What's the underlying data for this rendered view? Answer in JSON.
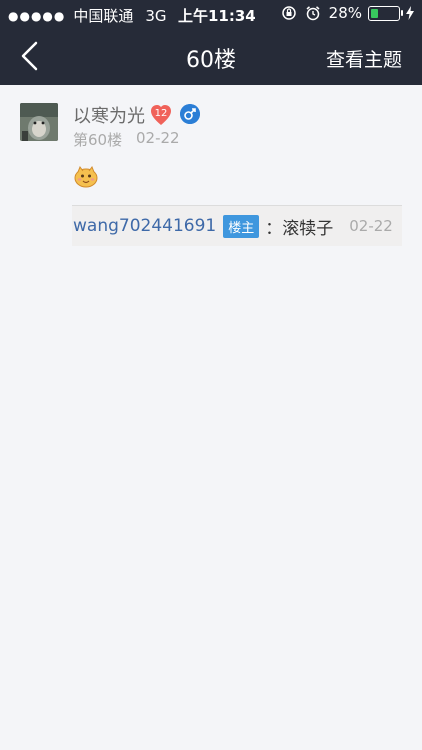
{
  "status": {
    "carrier": "中国联通",
    "network": "3G",
    "time": "上午11:34",
    "battery_percent": "28%",
    "battery_level": 0.28
  },
  "nav": {
    "title": "60楼",
    "right_action": "查看主题"
  },
  "post": {
    "username": "以寒为光",
    "level": "12",
    "gender": "male",
    "floor": "第60楼",
    "date": "02-22"
  },
  "reply": {
    "user": "wang702441691",
    "tag": "楼主",
    "text": "：滚犊子",
    "date": "02-22"
  },
  "colors": {
    "header_bg": "#262b38",
    "link_blue": "#3e69a8",
    "tag_blue": "#3f97de",
    "level_red": "#f0625a",
    "gender_blue": "#2b7ed6"
  }
}
